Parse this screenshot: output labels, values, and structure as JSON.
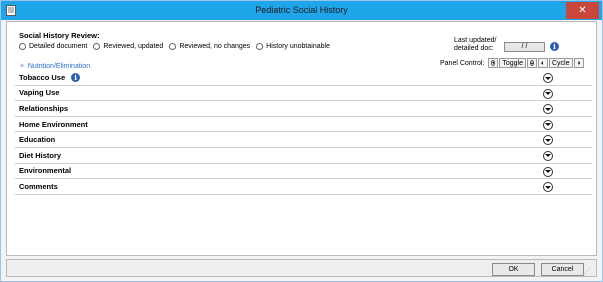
{
  "window": {
    "title": "Pediatric Social History",
    "close_glyph": "✕"
  },
  "review": {
    "label": "Social History Review:",
    "options": [
      "Detailed document",
      "Reviewed, updated",
      "Reviewed, no changes",
      "History unobtainable"
    ]
  },
  "last_updated": {
    "line1": "Last updated/",
    "line2": "detailed doc:",
    "value": "/ /"
  },
  "nutrition_link": {
    "plus": "✧",
    "label": "Nutrition/Elimination"
  },
  "panel_control": {
    "label": "Panel Control:",
    "toggle_label": "Toggle",
    "cycle_label": "Cycle"
  },
  "sections": [
    "Tobacco Use",
    "Vaping Use",
    "Relationships",
    "Home Environment",
    "Education",
    "Diet History",
    "Environmental",
    "Comments"
  ],
  "info_glyph": "i",
  "footer": {
    "ok_label": "OK",
    "cancel_label": "Cancel"
  },
  "colors": {
    "titlebar": "#1ea5ea",
    "close_button": "#c9483b",
    "link": "#2b6fd1",
    "info_icon": "#2b5fb4"
  }
}
